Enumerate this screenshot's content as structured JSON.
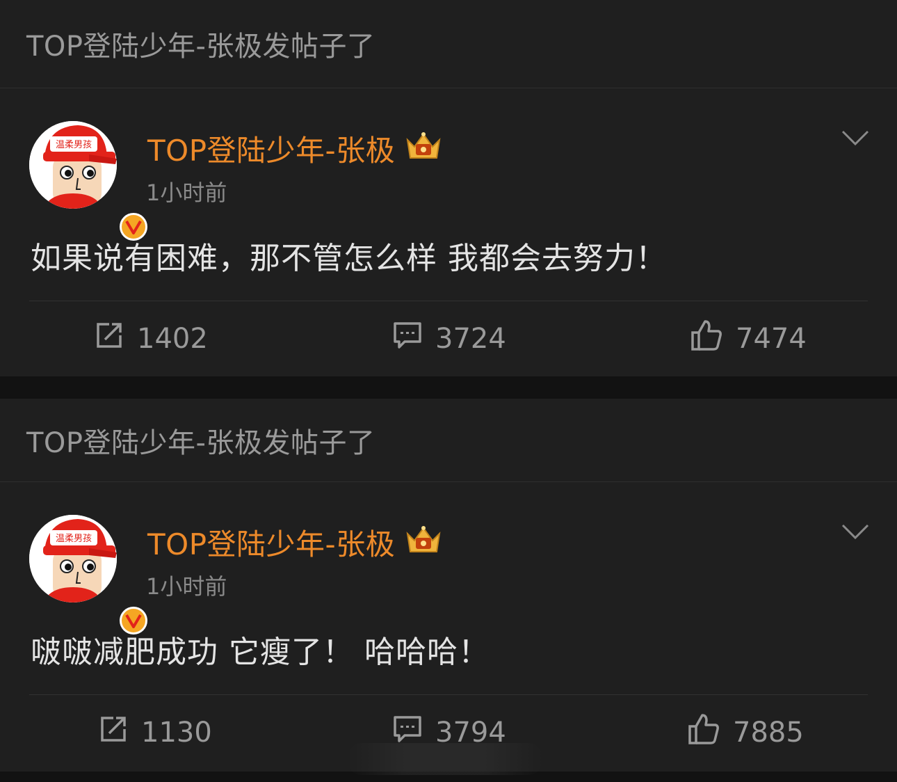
{
  "posts": [
    {
      "header": "TOP登陆少年-张极发帖子了",
      "avatar_text": "温柔男孩",
      "username": "TOP登陆少年-张极",
      "badge_icon": "crown-icon",
      "verified_icon": "verified-v-icon",
      "time": "1小时前",
      "text": "如果说有困难，那不管怎么样 我都会去努力！",
      "repost_count": "1402",
      "comment_count": "3724",
      "like_count": "7474"
    },
    {
      "header": "TOP登陆少年-张极发帖子了",
      "avatar_text": "温柔男孩",
      "username": "TOP登陆少年-张极",
      "badge_icon": "crown-icon",
      "verified_icon": "verified-v-icon",
      "time": "1小时前",
      "text": "啵啵减肥成功 它瘦了！ 哈哈哈！",
      "repost_count": "1130",
      "comment_count": "3794",
      "like_count": "7885"
    }
  ],
  "colors": {
    "background": "#121212",
    "card": "#1f1f1f",
    "username": "#ed8a2a",
    "muted": "#9a9a9a",
    "post_text": "#e4e4e4",
    "verified": "#f5a623"
  }
}
